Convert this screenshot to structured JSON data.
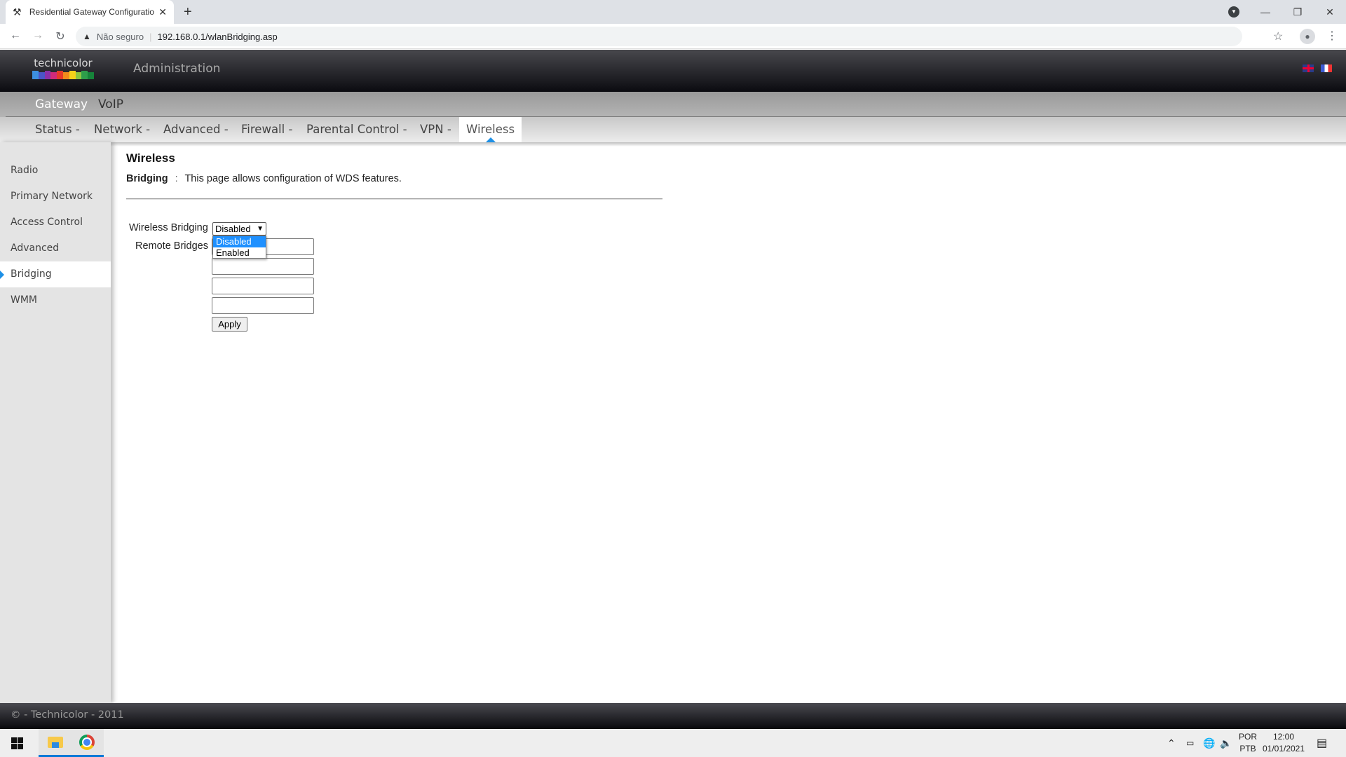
{
  "browser": {
    "tab_title": "Residential Gateway Configuration",
    "tab_icon": "tools-icon",
    "new_tab_label": "+",
    "security_label": "Não seguro",
    "url": "192.168.0.1/wlanBridging.asp",
    "window_controls": [
      "minimize",
      "restore",
      "close"
    ]
  },
  "header": {
    "logo_text": "technicolor",
    "logo_colors": [
      "#3d8fe0",
      "#4a55c8",
      "#8b2fa8",
      "#d12a7a",
      "#e63a2a",
      "#f08a1c",
      "#f5d21a",
      "#8cc63f",
      "#2e9d4a",
      "#16843a"
    ],
    "title": "Administration",
    "languages": [
      "English",
      "Français"
    ]
  },
  "nav_primary": {
    "items": [
      {
        "label": "Gateway",
        "active": true
      },
      {
        "label": "VoIP",
        "active": false
      }
    ]
  },
  "nav_secondary": {
    "items": [
      {
        "label": "Status -"
      },
      {
        "label": "Network -"
      },
      {
        "label": "Advanced -"
      },
      {
        "label": "Firewall -"
      },
      {
        "label": "Parental Control -"
      },
      {
        "label": "VPN -"
      }
    ],
    "active_label": "Wireless"
  },
  "sidebar": {
    "items": [
      {
        "label": "Radio"
      },
      {
        "label": "Primary Network"
      },
      {
        "label": "Access Control"
      },
      {
        "label": "Advanced"
      },
      {
        "label": "Bridging",
        "active": true
      },
      {
        "label": "WMM"
      }
    ]
  },
  "main": {
    "title": "Wireless",
    "section": "Bridging",
    "separator": ":",
    "description": "This page allows configuration of WDS features.",
    "form": {
      "wireless_bridging_label": "Wireless Bridging",
      "wireless_bridging_value": "Disabled",
      "wireless_bridging_options": [
        "Disabled",
        "Enabled"
      ],
      "dropdown_open": true,
      "dropdown_highlighted": "Disabled",
      "remote_bridges_label": "Remote Bridges",
      "remote_bridges": [
        "",
        "",
        "",
        ""
      ],
      "apply_label": "Apply"
    }
  },
  "footer": {
    "text": "© - Technicolor - 2011"
  },
  "taskbar": {
    "apps": [
      "Start",
      "File Explorer",
      "Google Chrome"
    ],
    "lang_top": "POR",
    "lang_bottom": "PTB",
    "time": "12:00",
    "date": "01/01/2021"
  }
}
